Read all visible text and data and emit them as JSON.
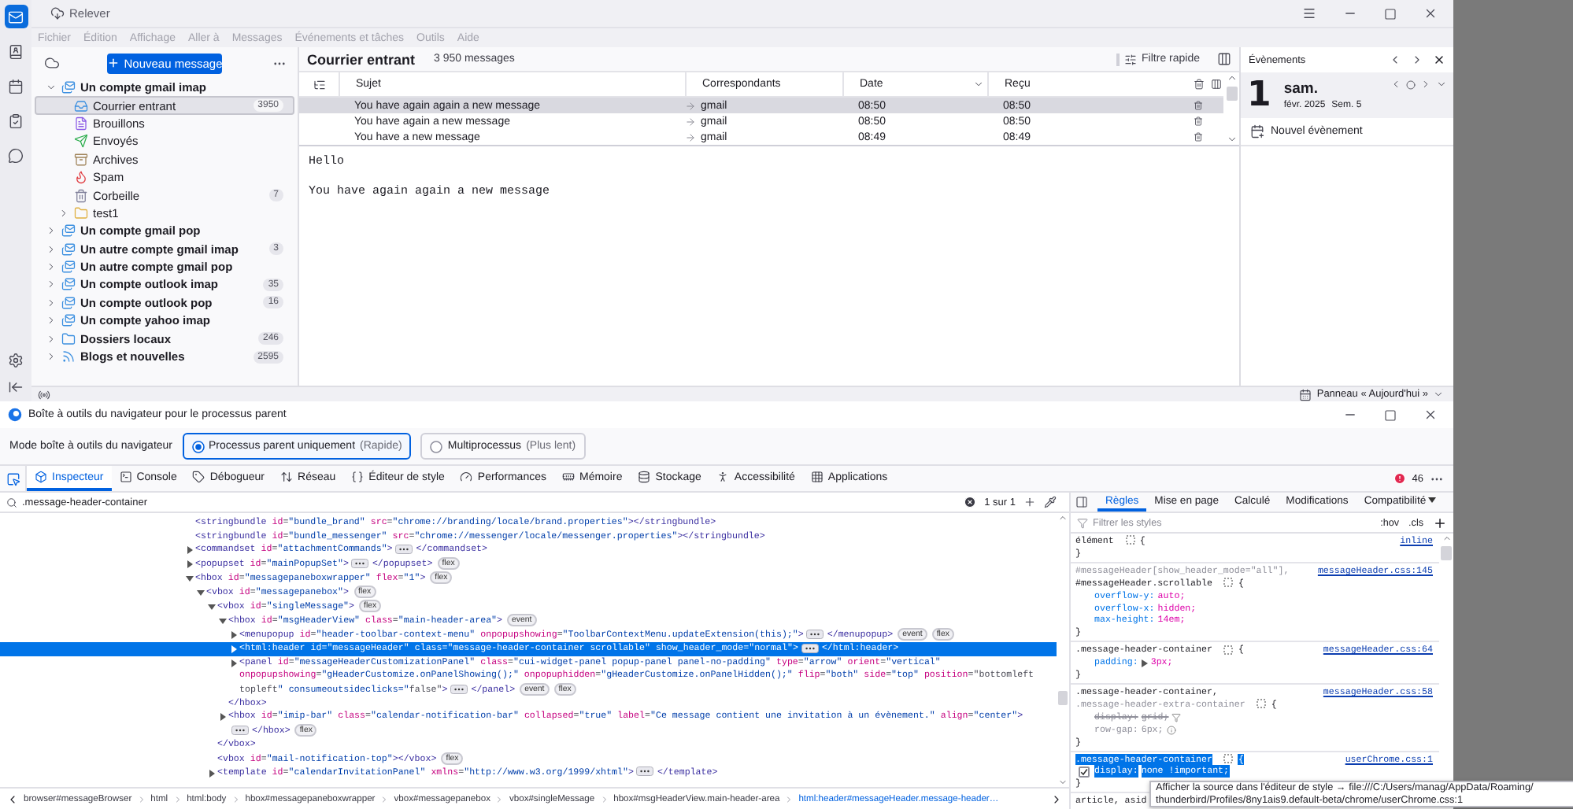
{
  "mail_window": {
    "title_button": "Relever",
    "spaces": [
      {
        "kind": "mail",
        "selected": true
      },
      {
        "kind": "contacts",
        "selected": false
      },
      {
        "kind": "calendar",
        "selected": false
      },
      {
        "kind": "tasks",
        "selected": false
      },
      {
        "kind": "chat",
        "selected": false
      }
    ],
    "menu": [
      {
        "label": "Fichier",
        "disabled": true
      },
      {
        "label": "Édition",
        "disabled": true
      },
      {
        "label": "Affichage",
        "disabled": true
      },
      {
        "label": "Aller à",
        "disabled": true
      },
      {
        "label": "Messages",
        "disabled": true
      },
      {
        "label": "Événements et tâches",
        "disabled": true
      },
      {
        "label": "Outils",
        "disabled": true
      },
      {
        "label": "Aide",
        "disabled": true
      }
    ],
    "new_message_button": "Nouveau message",
    "folders": [
      {
        "label": "Un compte gmail imap",
        "kind": "account",
        "expanded": true,
        "selected": false,
        "children": [
          {
            "label": "Courrier entrant",
            "kind": "inbox",
            "selected": true,
            "count": "3950"
          },
          {
            "label": "Brouillons",
            "kind": "drafts",
            "selected": false
          },
          {
            "label": "Envoyés",
            "kind": "sent",
            "selected": false
          },
          {
            "label": "Archives",
            "kind": "archive",
            "selected": false
          },
          {
            "label": "Spam",
            "kind": "spam",
            "selected": false
          },
          {
            "label": "Corbeille",
            "kind": "trash",
            "selected": false,
            "count": "7"
          },
          {
            "label": "test1",
            "kind": "folder",
            "expanded": false,
            "selected": false
          }
        ]
      },
      {
        "label": "Un compte gmail pop",
        "kind": "account",
        "expanded": false,
        "selected": false
      },
      {
        "label": "Un autre compte gmail imap",
        "kind": "account",
        "expanded": false,
        "selected": false,
        "count": "3"
      },
      {
        "label": "Un autre compte gmail pop",
        "kind": "account",
        "expanded": false,
        "selected": false
      },
      {
        "label": "Un compte outlook imap",
        "kind": "account",
        "expanded": false,
        "selected": false,
        "count": "35"
      },
      {
        "label": "Un compte outlook pop",
        "kind": "account",
        "expanded": false,
        "selected": false,
        "count": "16"
      },
      {
        "label": "Un compte yahoo imap",
        "kind": "account",
        "expanded": false,
        "selected": false
      },
      {
        "label": "Dossiers locaux",
        "kind": "local",
        "expanded": false,
        "selected": false,
        "count": "246"
      },
      {
        "label": "Blogs et nouvelles",
        "kind": "feeds",
        "expanded": false,
        "selected": false,
        "count": "2595"
      }
    ],
    "message_list": {
      "folder": "Courrier entrant",
      "count": "3 950 messages",
      "quick_filter": "Filtre rapide",
      "columns": [
        "Sujet",
        "Correspondants",
        "Date",
        "Reçu"
      ],
      "rows": [
        {
          "subject": "You have again again a new message",
          "correspondent": "gmail",
          "date": "08:50",
          "received": "08:50",
          "selected": true
        },
        {
          "subject": "You have again a new message",
          "correspondent": "gmail",
          "date": "08:50",
          "received": "08:50",
          "selected": false
        },
        {
          "subject": "You have a new message",
          "correspondent": "gmail",
          "date": "08:49",
          "received": "08:49",
          "selected": false
        }
      ]
    },
    "message_body": [
      "Hello",
      "You have again again a new message"
    ],
    "events": {
      "title": "Évènements",
      "day": "1",
      "weekday": "sam.",
      "month": "févr. 2025",
      "week": "Sem. 5",
      "new_event": "Nouvel évènement"
    },
    "status_bar": {
      "today_pane": "Panneau « Aujourd'hui »"
    }
  },
  "devtools": {
    "title": "Boîte à outils du navigateur pour le processus parent",
    "mode_label": "Mode boîte à outils du navigateur",
    "modes": [
      {
        "label": "Processus parent uniquement",
        "hint": "(Rapide)",
        "selected": true
      },
      {
        "label": "Multiprocessus",
        "hint": "(Plus lent)",
        "selected": false
      }
    ],
    "tabs": [
      {
        "label": "Inspecteur",
        "kind": "inspector",
        "selected": true
      },
      {
        "label": "Console",
        "kind": "console",
        "selected": false
      },
      {
        "label": "Débogueur",
        "kind": "debugger",
        "selected": false
      },
      {
        "label": "Réseau",
        "kind": "network",
        "selected": false
      },
      {
        "label": "Éditeur de style",
        "kind": "style",
        "selected": false
      },
      {
        "label": "Performances",
        "kind": "performance",
        "selected": false
      },
      {
        "label": "Mémoire",
        "kind": "memory",
        "selected": false
      },
      {
        "label": "Stockage",
        "kind": "storage",
        "selected": false
      },
      {
        "label": "Accessibilité",
        "kind": "accessibility",
        "selected": false
      },
      {
        "label": "Applications",
        "kind": "applications",
        "selected": false
      }
    ],
    "error_count": "46",
    "search": {
      "value": ".message-header-container",
      "result": "1 sur 1"
    },
    "markup": [
      {
        "open": "<stringbundle id=\"bundle_brand\" src=\"chrome://branding/locale/brand.properties\"></stringbundle>",
        "selected": false
      },
      {
        "open": "<stringbundle id=\"bundle_messenger\" src=\"chrome://messenger/locale/messenger.properties\"></stringbundle>",
        "selected": false
      },
      {
        "open": "<commandset id=\"attachmentCommands\">",
        "close": "</commandset>",
        "expanded": false,
        "selected": false
      },
      {
        "open": "<popupset id=\"mainPopupSet\">",
        "close": "</popupset>",
        "expanded": false,
        "selected": false,
        "badges": [
          "flex"
        ]
      },
      {
        "open": "<hbox id=\"messagepaneboxwrapper\" flex=\"1\">",
        "expanded": true,
        "selected": false,
        "badges": [
          "flex"
        ],
        "children": [
          {
            "open": "<vbox id=\"messagepanebox\">",
            "expanded": true,
            "selected": false,
            "badges": [
              "flex"
            ],
            "children": [
              {
                "open": "<vbox id=\"singleMessage\">",
                "close": "</vbox>",
                "expanded": true,
                "selected": false,
                "badges": [
                  "flex"
                ],
                "children": [
                  {
                    "open": "<hbox id=\"msgHeaderView\" class=\"main-header-area\">",
                    "close": "</hbox>",
                    "expanded": true,
                    "selected": false,
                    "badges": [
                      "event"
                    ],
                    "children": [
                      {
                        "open": "<menupopup id=\"header-toolbar-context-menu\" onpopupshowing=\"ToolbarContextMenu.updateExtension(this);\">",
                        "close": "</menupopup>",
                        "expanded": false,
                        "selected": false,
                        "badges": [
                          "event",
                          "flex"
                        ]
                      },
                      {
                        "open": "<html:header id=\"messageHeader\" class=\"message-header-container scrollable\" show_header_mode=\"normal\">",
                        "close": "</html:header>",
                        "expanded": false,
                        "selected": true
                      },
                      {
                        "open": [
                          "<panel id=\"messageHeaderCustomizationPanel\" class=\"cui-widget-panel popup-panel panel-no-padding\" type=\"arrow\" orient=\"vertical\"",
                          "onpopupshowing=\"gHeaderCustomize.onPanelShowing();\" onpopuphidden=\"gHeaderCustomize.onPanelHidden();\" flip=\"both\" side=\"top\" position=\"bottomleft",
                          "topleft\" consumeoutsideclicks=\"false\">"
                        ],
                        "close": "</panel>",
                        "expanded": false,
                        "selected": false,
                        "badges": [
                          "event",
                          "flex"
                        ]
                      }
                    ]
                  },
                  {
                    "open": "<hbox id=\"imip-bar\" class=\"calendar-notification-bar\" collapsed=\"true\" label=\"Ce message contient une invitation à un évènement.\" align=\"center\">",
                    "close": "</hbox>",
                    "expanded": false,
                    "selected": false,
                    "badges": [
                      "flex"
                    ]
                  }
                ]
              },
              {
                "open": "<vbox id=\"mail-notification-top\"></vbox>",
                "selected": false,
                "badges": [
                  "flex"
                ]
              },
              {
                "open": "<template id=\"calendarInvitationPanel\" xmlns=\"http://www.w3.org/1999/xhtml\">",
                "close": "</template>",
                "expanded": false,
                "selected": false
              }
            ]
          }
        ]
      }
    ],
    "breadcrumbs": [
      {
        "label": "browser#messageBrowser",
        "selected": false
      },
      {
        "label": "html",
        "selected": false
      },
      {
        "label": "html:body",
        "selected": false
      },
      {
        "label": "hbox#messagepaneboxwrapper",
        "selected": false
      },
      {
        "label": "vbox#messagepanebox",
        "selected": false
      },
      {
        "label": "vbox#singleMessage",
        "selected": false
      },
      {
        "label": "hbox#msgHeaderView.main-header-area",
        "selected": false
      },
      {
        "label": "html:header#messageHeader.message-header…",
        "selected": true
      }
    ],
    "sidebar_tabs": [
      {
        "label": "Règles",
        "selected": true
      },
      {
        "label": "Mise en page",
        "selected": false
      },
      {
        "label": "Calculé",
        "selected": false
      },
      {
        "label": "Modifications",
        "selected": false
      },
      {
        "label": "Compatibilité",
        "selected": false
      }
    ],
    "filter_placeholder": "Filtrer les styles",
    "pseudo_buttons": [
      ":hov",
      ".cls"
    ],
    "rules": [
      {
        "selectors": [
          {
            "text": "élément",
            "matched": true
          }
        ],
        "source": "inline",
        "open": "{",
        "close": "}",
        "highlighted": false
      },
      {
        "selectors": [
          {
            "text": "#messageHeader[show_header_mode=\"all\"],",
            "matched": false
          },
          {
            "text": "#messageHeader.scrollable",
            "matched": true
          }
        ],
        "source": "messageHeader.css:145",
        "open": "{",
        "close": "}",
        "highlighted": false,
        "declarations": [
          {
            "property": "overflow-y:",
            "value": "auto;",
            "overridden": false,
            "inactive": false,
            "expandable": false
          },
          {
            "property": "overflow-x:",
            "value": "hidden;",
            "overridden": false,
            "inactive": false,
            "expandable": false
          },
          {
            "property": "max-height:",
            "value": "14em;",
            "overridden": false,
            "inactive": false,
            "expandable": false
          }
        ]
      },
      {
        "selectors": [
          {
            "text": ".message-header-container",
            "matched": true
          }
        ],
        "source": "messageHeader.css:64",
        "open": "{",
        "close": "}",
        "highlighted": false,
        "declarations": [
          {
            "property": "padding:",
            "value": "3px;",
            "overridden": false,
            "inactive": false,
            "expandable": true
          }
        ]
      },
      {
        "selectors": [
          {
            "text": ".message-header-container,",
            "matched": true
          },
          {
            "text": ".message-header-extra-container",
            "matched": false
          }
        ],
        "source": "messageHeader.css:58",
        "open": "{",
        "close": "}",
        "highlighted": false,
        "declarations": [
          {
            "property": "display:",
            "value": "grid;",
            "overridden": true,
            "inactive": false,
            "expandable": false
          },
          {
            "property": "row-gap:",
            "value": "6px;",
            "overridden": false,
            "inactive": true,
            "expandable": false
          }
        ]
      },
      {
        "selectors": [
          {
            "text": ".message-header-container",
            "matched": true
          }
        ],
        "source": "userChrome.css:1",
        "open": "{",
        "close": "}",
        "highlighted": true,
        "declarations": [
          {
            "property": "display:",
            "value": "none !important;",
            "overridden": false,
            "inactive": false,
            "expandable": false,
            "checked": true
          }
        ]
      }
    ],
    "rules_tail": "article, asid",
    "tooltip": [
      "Afficher la source dans l'éditeur de style → file:///C:/Users/manag/AppData/Roaming/",
      "thunderbird/Profiles/8ny1ais9.default-beta/chrome/userChrome.css:1"
    ]
  }
}
